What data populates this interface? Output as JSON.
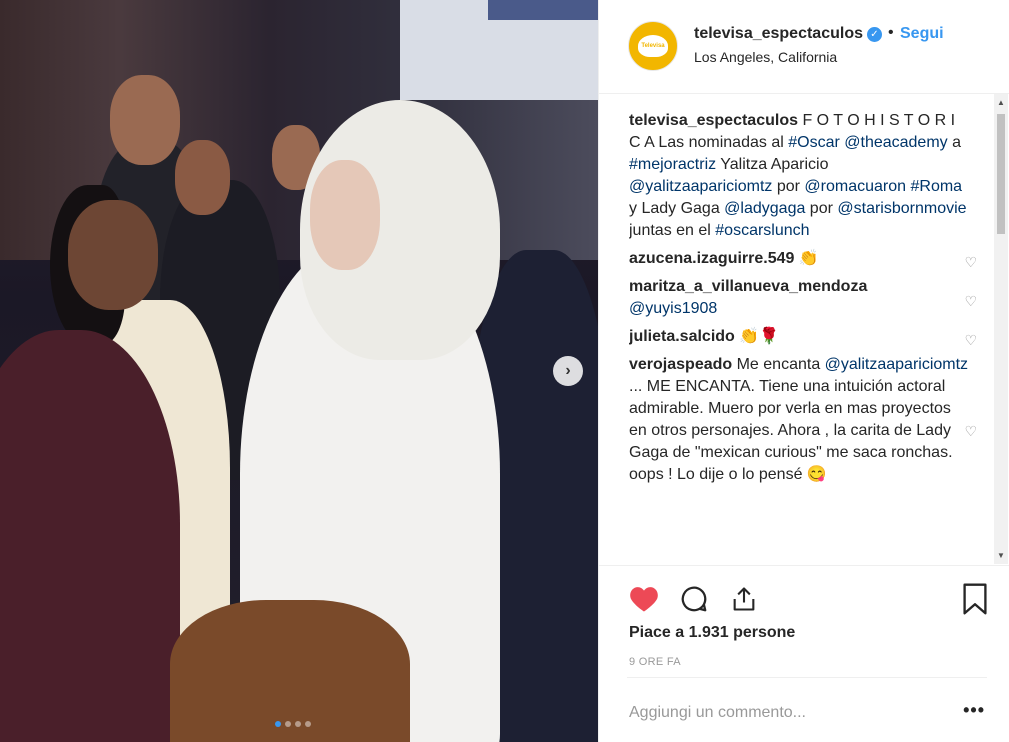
{
  "header": {
    "username": "televisa_espectaculos",
    "separator": "•",
    "follow_label": "Segui",
    "location": "Los Angeles, California",
    "avatar_text": "Televisa"
  },
  "caption": {
    "username": "televisa_espectaculos",
    "t1": " F O T O H I S T O R I C A Las nominadas al ",
    "l1": "#Oscar",
    "t2": " ",
    "l2": "@theacademy",
    "t3": " a ",
    "l3": "#mejoractriz",
    "t4": " Yalitza Aparicio ",
    "l4": "@yalitzaapariciomtz",
    "t5": " por ",
    "l5": "@romacuaron",
    "t6": " ",
    "l6": "#Roma",
    "t7": " y Lady Gaga ",
    "l7": "@ladygaga",
    "t8": " por ",
    "l8": "@starisbornmovie",
    "t9": " juntas en el ",
    "l9": "#oscarslunch"
  },
  "comments": [
    {
      "username": "azucena.izaguirre.549",
      "text": " 👏"
    },
    {
      "username": "maritza_a_villanueva_mendoza",
      "link": "@yuyis1908"
    },
    {
      "username": "julieta.salcido",
      "text": " 👏🌹"
    },
    {
      "username": "verojaspeado",
      "text_a": " Me encanta ",
      "link": "@yalitzaapariciomtz",
      "text_b": " ... ME ENCANTA. Tiene una intuición actoral admirable. Muero por verla en mas proyectos en otros personajes. Ahora , la carita de Lady Gaga de \"mexican curious\" me saca ronchas. oops ! Lo dije o lo pensé 😋"
    }
  ],
  "likes": "Piace a 1.931 persone",
  "time": "9 ORE FA",
  "add_comment_placeholder": "Aggiungi un commento...",
  "more_label": "•••",
  "colors": {
    "accent": "#3897f0",
    "heart": "#ed4956",
    "avatar_bg": "#f2b600"
  },
  "icons": [
    "verified-icon",
    "heart-icon",
    "comment-icon",
    "share-icon",
    "bookmark-icon",
    "next-arrow-icon"
  ]
}
